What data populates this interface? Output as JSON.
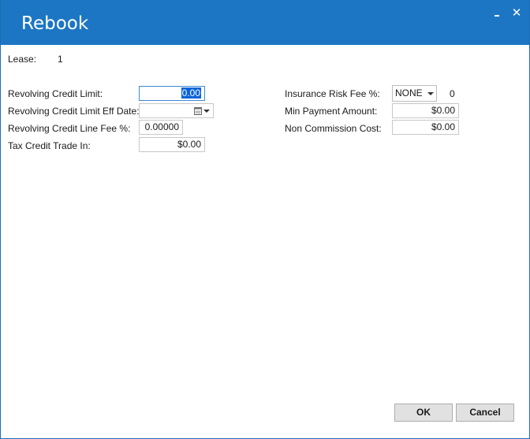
{
  "window": {
    "title": "Rebook",
    "minimize_icon": "minimize-icon",
    "close_icon": "close-icon",
    "close_glyph": "✕",
    "titlebar_color": "#1c76c4"
  },
  "lease": {
    "label": "Lease:",
    "value": "1"
  },
  "left_fields": {
    "revolving_credit_limit": {
      "label": "Revolving Credit Limit:",
      "value": "0.00"
    },
    "revolving_credit_limit_eff_date": {
      "label": "Revolving Credit Limit Eff Date:",
      "value": "",
      "icon": "calendar-icon"
    },
    "revolving_credit_line_fee": {
      "label": "Revolving Credit Line Fee %:",
      "value": "0.00000"
    },
    "tax_credit_trade_in": {
      "label": "Tax Credit Trade In:",
      "value": "$0.00"
    }
  },
  "right_fields": {
    "insurance_risk_fee": {
      "label": "Insurance Risk Fee %:",
      "selected": "NONE",
      "value": "0"
    },
    "min_payment_amount": {
      "label": "Min Payment Amount:",
      "value": "$0.00"
    },
    "non_commission_cost": {
      "label": "Non Commission Cost:",
      "value": "$0.00"
    }
  },
  "buttons": {
    "ok": "OK",
    "cancel": "Cancel"
  }
}
